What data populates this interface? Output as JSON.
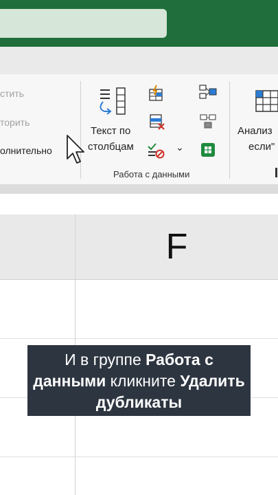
{
  "search": {
    "value": ""
  },
  "ribbon": {
    "sort_filter": {
      "reapply_label": "стить",
      "reapply2_label": "торить",
      "advanced_label": "олнительно"
    },
    "data_tools": {
      "text_to_columns_line1": "Текст по",
      "text_to_columns_line2": "столбцам",
      "group_label": "Работа с данными"
    },
    "forecast": {
      "what_if_line1": "Анализ",
      "what_if_line2": "если\""
    }
  },
  "sheet": {
    "column_f": "F"
  },
  "caption": {
    "p1": "И в группе ",
    "b1": "Работа с данными",
    "p2": " кликните ",
    "b2": "Удалить дубликаты"
  },
  "colors": {
    "title_bar": "#1f6e3b",
    "caption_bg": "#2d3540",
    "ribbon_bg": "#f7f7f7"
  }
}
